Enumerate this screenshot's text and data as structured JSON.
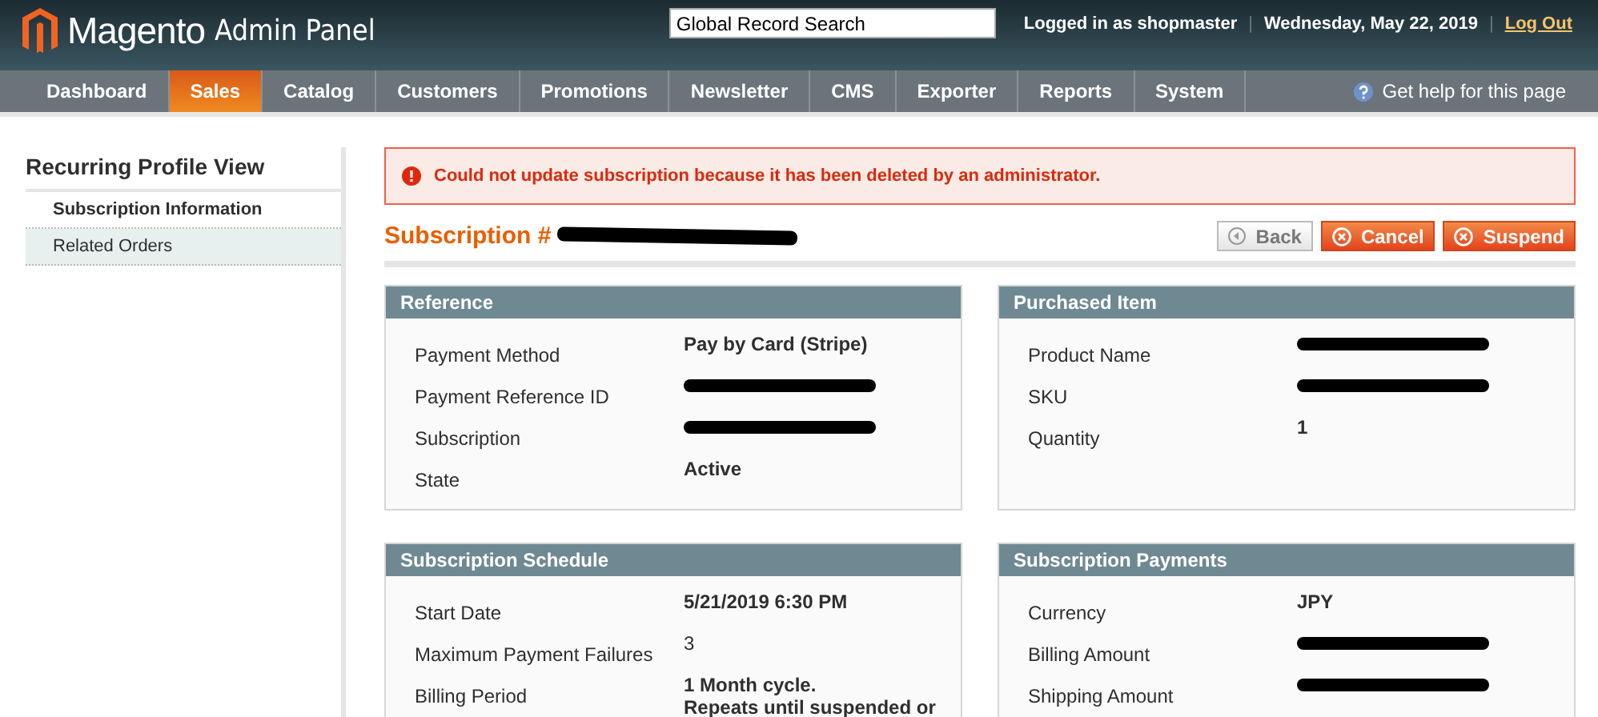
{
  "header": {
    "logo_text": "Magento",
    "logo_subtitle": "Admin Panel",
    "search": {
      "value": "Global Record Search"
    },
    "user_text": "Logged in as shopmaster",
    "separators": [
      "|",
      "|"
    ],
    "date": "Wednesday, May 22, 2019",
    "logout": "Log Out"
  },
  "nav": [
    {
      "label": "Dashboard",
      "selected": false
    },
    {
      "label": "Sales",
      "selected": true
    },
    {
      "label": "Catalog",
      "selected": false
    },
    {
      "label": "Customers",
      "selected": false
    },
    {
      "label": "Promotions",
      "selected": false
    },
    {
      "label": "Newsletter",
      "selected": false
    },
    {
      "label": "CMS",
      "selected": false
    },
    {
      "label": "Exporter",
      "selected": false
    },
    {
      "label": "Reports",
      "selected": false
    },
    {
      "label": "System",
      "selected": false
    }
  ],
  "help": "Get help for this page",
  "sidebar": {
    "title": "Recurring Profile View",
    "items": [
      {
        "label": "Subscription Information",
        "selected": true
      },
      {
        "label": "Related Orders",
        "selected": false
      }
    ]
  },
  "error_message": "Could not update subscription because it has been deleted by an administrator.",
  "page_title": {
    "text": "Subscription #",
    "redacted": true
  },
  "buttons": [
    {
      "label": "Back",
      "kind": "back"
    },
    {
      "label": "Cancel",
      "kind": "cancel"
    },
    {
      "label": "Suspend",
      "kind": "suspend"
    }
  ],
  "panels": [
    {
      "title": "Reference",
      "rows": [
        {
          "label": "Payment Method",
          "value": "Pay by Card (Stripe)",
          "redacted": false
        },
        {
          "label": "Payment Reference ID",
          "redacted": true
        },
        {
          "label": "Subscription",
          "redacted": true
        },
        {
          "label": "State",
          "value": "Active",
          "redacted": false
        }
      ]
    },
    {
      "title": "Purchased Item",
      "rows": [
        {
          "label": "Product Name",
          "redacted": true
        },
        {
          "label": "SKU",
          "redacted": true
        },
        {
          "label": "Quantity",
          "value": "1",
          "redacted": false
        }
      ]
    },
    {
      "title": "Subscription Schedule",
      "rows": [
        {
          "label": "Start Date",
          "value": "5/21/2019 6:30 PM",
          "redacted": false
        },
        {
          "label": "Maximum Payment Failures",
          "value": "3",
          "redacted": false,
          "plain": true
        },
        {
          "label": "Billing Period",
          "value": "1 Month cycle.",
          "extra": "Repeats until suspended or",
          "redacted": false
        }
      ]
    },
    {
      "title": "Subscription Payments",
      "rows": [
        {
          "label": "Currency",
          "value": "JPY",
          "redacted": false
        },
        {
          "label": "Billing Amount",
          "redacted": true
        },
        {
          "label": "Shipping Amount",
          "redacted": true
        }
      ]
    }
  ]
}
